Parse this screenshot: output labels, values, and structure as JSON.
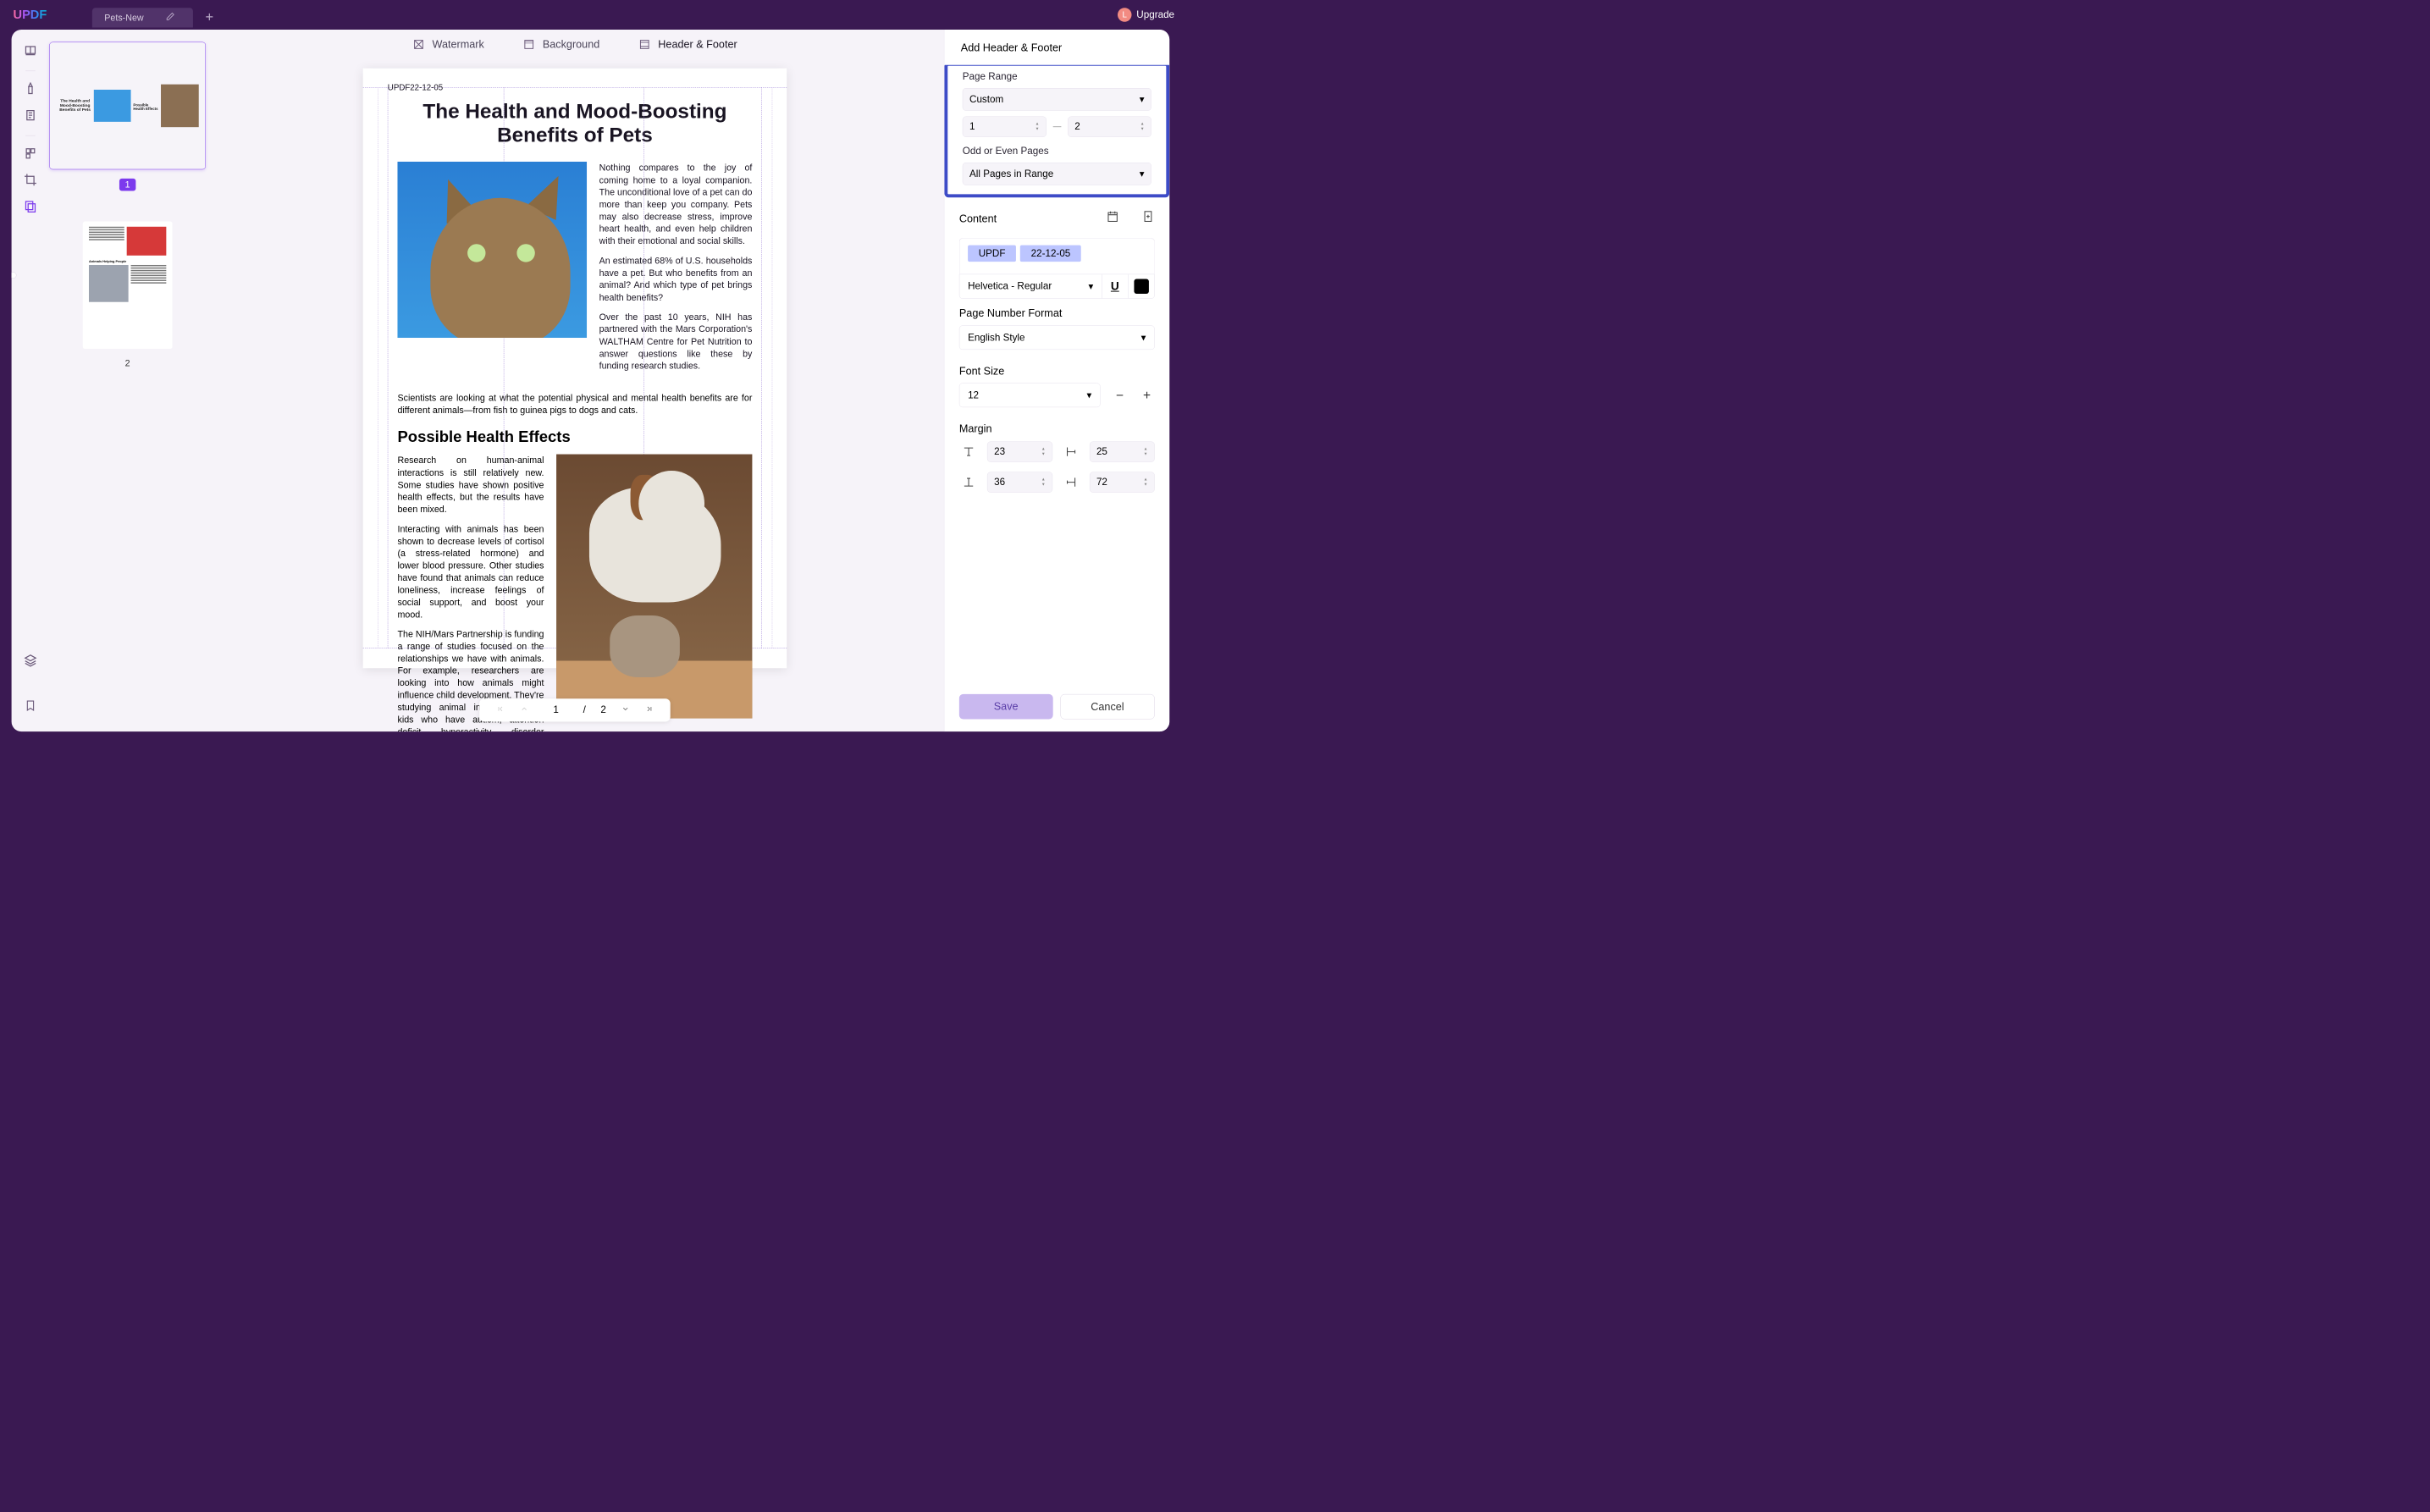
{
  "app": {
    "logo": "UPDF",
    "upgrade": "Upgrade",
    "avatar": "L"
  },
  "tab": {
    "name": "Pets-New"
  },
  "top_tabs": {
    "watermark": "Watermark",
    "background": "Background",
    "header_footer": "Header & Footer"
  },
  "thumbs": {
    "badge": "1",
    "page2": "2"
  },
  "doc": {
    "hf_text": "UPDF22-12-05",
    "title": "The Health and Mood-Boosting Benefits of Pets",
    "p1": "Nothing compares to the joy of coming home to a loyal companion. The unconditional love of a pet can do more than keep you company. Pets may also decrease stress, improve heart health, and even help children with their emotional and social skills.",
    "p2": "An estimated 68% of U.S. households have a pet. But who benefits from an animal? And which type of pet brings health benefits?",
    "p3": "Over the past 10 years, NIH has partnered with the Mars Corporation's WALTHAM Centre for Pet Nutrition to answer questions like these by funding research studies.",
    "p4": "Scientists are looking at what the potential physical and mental health benefits are for different animals—from fish to guinea pigs to dogs and cats.",
    "h2": "Possible Health Effects",
    "p5": "Research on human-animal interactions is still relatively new. Some studies have shown positive health effects, but the results have been mixed.",
    "p6": "Interacting with animals has been shown to decrease levels of cortisol (a stress-related hormone) and lower blood pressure. Other studies have found that animals can reduce loneliness, increase feelings of social support, and boost your mood.",
    "p7": "The NIH/Mars Partnership is funding a range of studies focused on the relationships we have with animals. For example, researchers are looking into how animals might influence child development. They're studying animal interactions with kids who have autism, attention deficit hyperactivity disorder (ADHD), and other conditions."
  },
  "pager": {
    "current": "1",
    "total": "2"
  },
  "panel": {
    "title": "Add Header & Footer",
    "page_range_lbl": "Page Range",
    "page_range_val": "Custom",
    "range_from": "1",
    "range_to": "2",
    "odd_even_lbl": "Odd or Even Pages",
    "odd_even_val": "All Pages in Range",
    "content_lbl": "Content",
    "chip1": "UPDF",
    "chip2": "22-12-05",
    "font_val": "Helvetica - Regular",
    "pnf_lbl": "Page Number Format",
    "pnf_val": "English Style",
    "fontsize_lbl": "Font Size",
    "fontsize_val": "12",
    "margin_lbl": "Margin",
    "m_top": "23",
    "m_left": "25",
    "m_bot": "36",
    "m_right": "72",
    "save": "Save",
    "cancel": "Cancel"
  }
}
